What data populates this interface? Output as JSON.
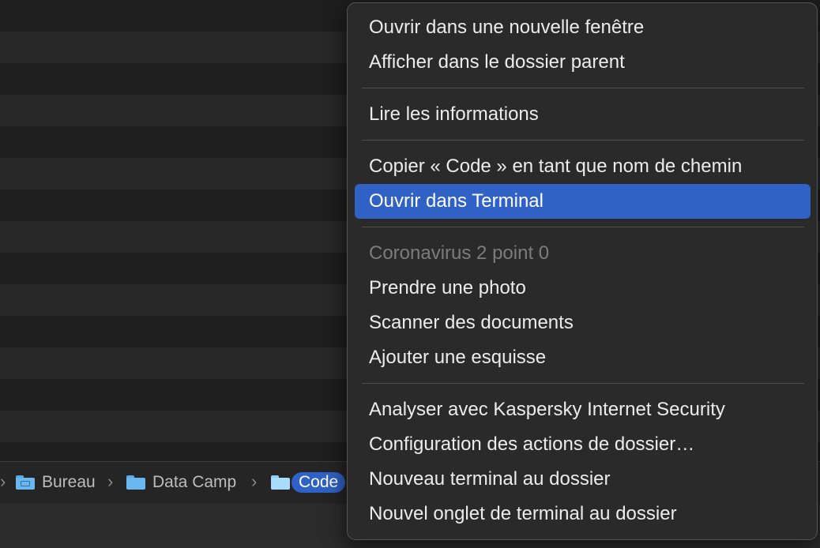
{
  "path_bar": {
    "items": [
      {
        "label": "Bureau"
      },
      {
        "label": "Data Camp"
      },
      {
        "label": "Code"
      }
    ],
    "separator": "›"
  },
  "context_menu": {
    "groups": [
      [
        "Ouvrir dans une nouvelle fenêtre",
        "Afficher dans le dossier parent"
      ],
      [
        "Lire les informations"
      ],
      [
        "Copier « Code » en tant que nom de chemin",
        "Ouvrir dans Terminal"
      ],
      [
        "Coronavirus 2 point 0",
        "Prendre une photo",
        "Scanner des documents",
        "Ajouter une esquisse"
      ],
      [
        "Analyser avec Kaspersky Internet Security",
        "Configuration des actions de dossier…",
        "Nouveau terminal au dossier",
        "Nouvel onglet de terminal au dossier"
      ]
    ],
    "highlighted_item": "Ouvrir dans Terminal",
    "disabled_item": "Coronavirus 2 point 0"
  },
  "colors": {
    "highlight": "#2f62c4",
    "menu_background": "#2a2a2b",
    "folder_blue": "#6bb8f0"
  },
  "icons": [
    "folder-icon",
    "chevron-right-icon"
  ]
}
